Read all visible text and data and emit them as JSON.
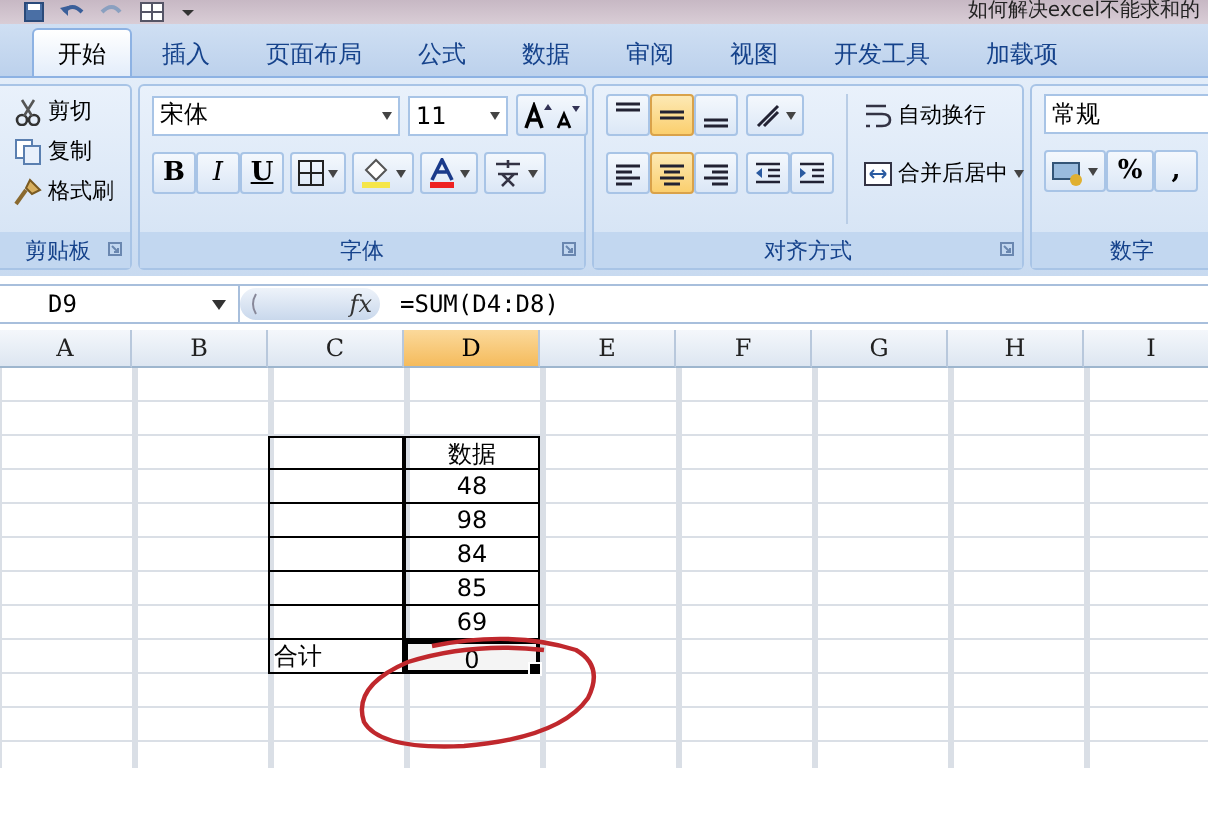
{
  "window": {
    "title": "如何解决excel不能求和的"
  },
  "tabs": [
    {
      "label": "开始",
      "selected": true
    },
    {
      "label": "插入",
      "selected": false
    },
    {
      "label": "页面布局",
      "selected": false
    },
    {
      "label": "公式",
      "selected": false
    },
    {
      "label": "数据",
      "selected": false
    },
    {
      "label": "审阅",
      "selected": false
    },
    {
      "label": "视图",
      "selected": false
    },
    {
      "label": "开发工具",
      "selected": false
    },
    {
      "label": "加载项",
      "selected": false
    }
  ],
  "clipboard": {
    "items": [
      "剪切",
      "复制",
      "格式刷"
    ],
    "label": "剪贴板"
  },
  "font": {
    "name": "宋体",
    "size": "11",
    "bold": "B",
    "italic": "I",
    "underline": "U",
    "label": "字体"
  },
  "alignment": {
    "vertical": [
      {
        "selected": false
      },
      {
        "selected": true
      },
      {
        "selected": false
      }
    ],
    "horizontal": [
      {
        "selected": false
      },
      {
        "selected": true
      },
      {
        "selected": false
      }
    ],
    "wrap": "自动换行",
    "merge": "合并后居中",
    "label": "对齐方式"
  },
  "number": {
    "format": "常规",
    "percent": "%",
    "comma": ",",
    "label": "数字"
  },
  "formula_bar": {
    "name_box": "D9",
    "fx": "fx",
    "formula": "=SUM(D4:D8)"
  },
  "sheet": {
    "columns": [
      {
        "label": "A",
        "selected": false
      },
      {
        "label": "B",
        "selected": false
      },
      {
        "label": "C",
        "selected": false
      },
      {
        "label": "D",
        "selected": true
      },
      {
        "label": "E",
        "selected": false
      },
      {
        "label": "F",
        "selected": false
      },
      {
        "label": "G",
        "selected": false
      },
      {
        "label": "H",
        "selected": false
      },
      {
        "label": "I",
        "selected": false
      }
    ],
    "table_rows": [
      {
        "selected": false,
        "d": "数据"
      },
      {
        "selected": false,
        "d": "48"
      },
      {
        "selected": false,
        "d": "98"
      },
      {
        "selected": false,
        "d": "84"
      },
      {
        "selected": false,
        "d": "85"
      },
      {
        "selected": false,
        "d": "69"
      },
      {
        "selected": true,
        "c": "合计",
        "d": "0"
      }
    ],
    "annotation": {
      "kind": "circle",
      "color": "#c0282d"
    }
  }
}
